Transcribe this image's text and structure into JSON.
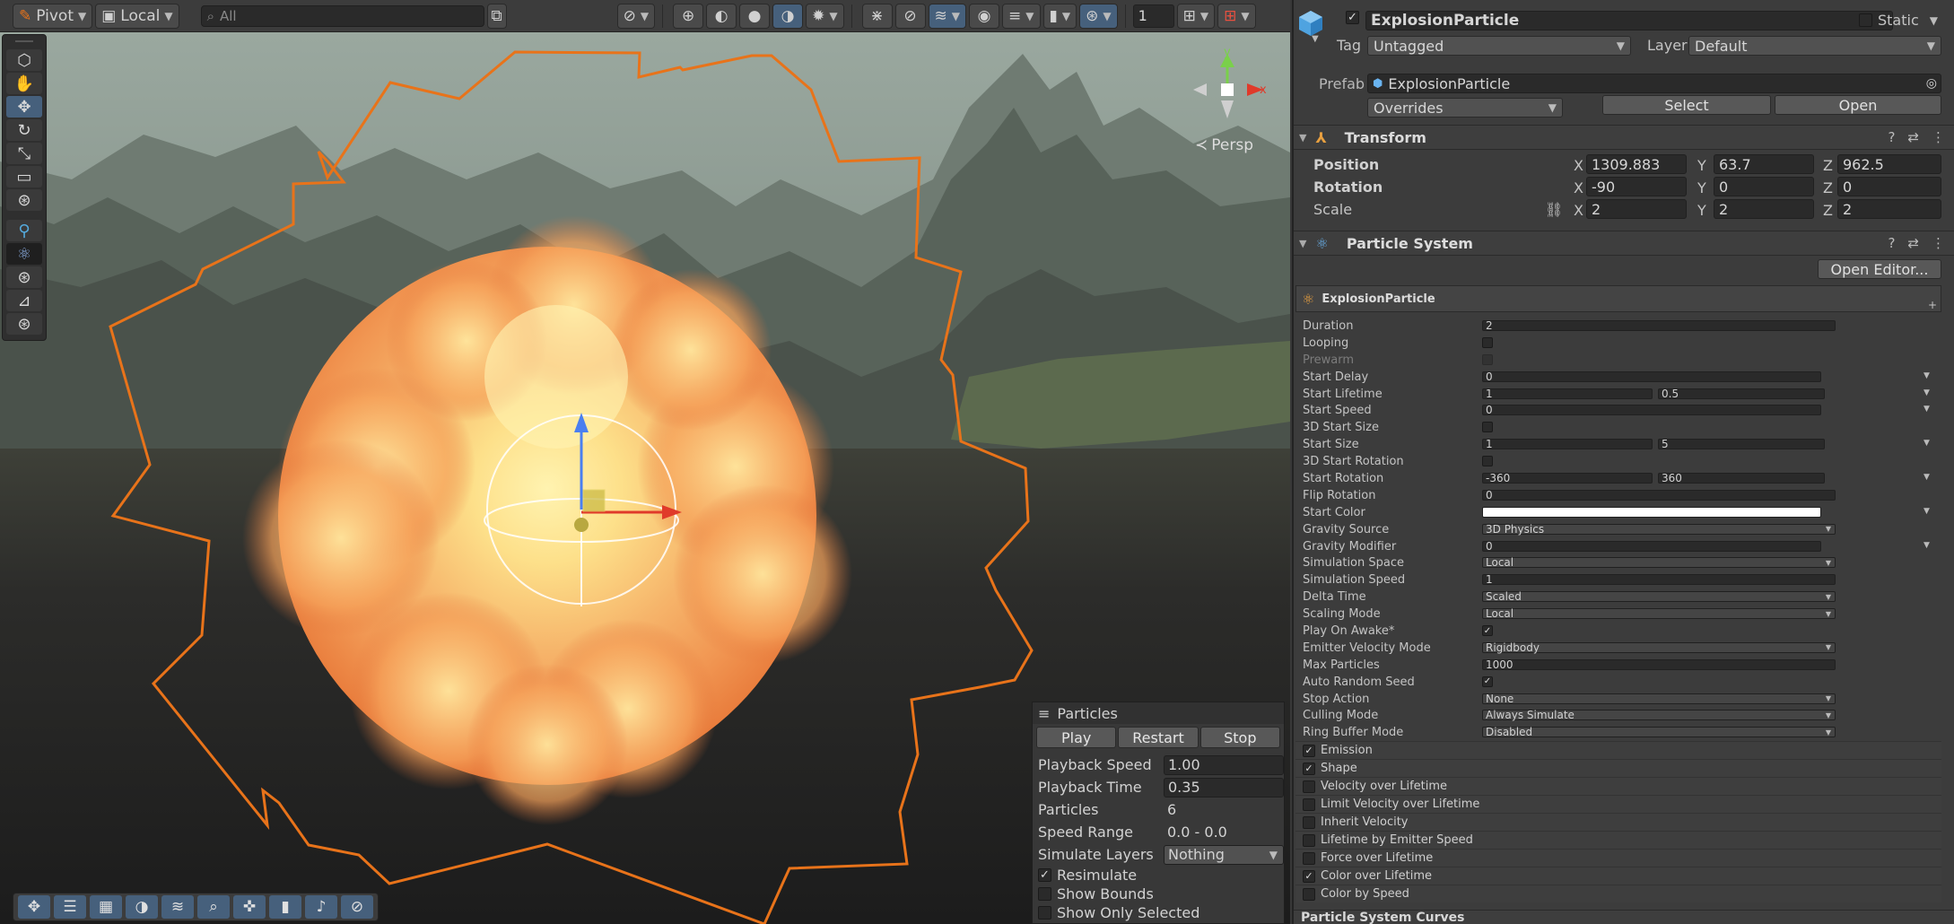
{
  "toolbar": {
    "pivot_label": "Pivot",
    "local_label": "Local",
    "search_placeholder": "All",
    "grid_count": "1"
  },
  "scene": {
    "persp_label": "Persp",
    "gizmo_axes": {
      "x": "x",
      "y": "y"
    }
  },
  "particles_overlay": {
    "title": "Particles",
    "play_label": "Play",
    "restart_label": "Restart",
    "stop_label": "Stop",
    "rows": [
      {
        "label": "Playback Speed",
        "value": "1.00"
      },
      {
        "label": "Playback Time",
        "value": "0.35"
      },
      {
        "label": "Particles",
        "value": "6"
      },
      {
        "label": "Speed Range",
        "value": "0.0 - 0.0"
      },
      {
        "label": "Simulate Layers",
        "value": "Nothing"
      }
    ],
    "checks": [
      {
        "label": "Resimulate",
        "checked": true
      },
      {
        "label": "Show Bounds",
        "checked": false
      },
      {
        "label": "Show Only Selected",
        "checked": false
      }
    ]
  },
  "inspector": {
    "object_name": "ExplosionParticle",
    "static_label": "Static",
    "tag_label": "Tag",
    "tag_value": "Untagged",
    "layer_label": "Layer",
    "layer_value": "Default",
    "prefab_label": "Prefab",
    "prefab_value": "ExplosionParticle",
    "overrides_label": "Overrides",
    "select_label": "Select",
    "open_label": "Open",
    "transform": {
      "title": "Transform",
      "position_label": "Position",
      "rotation_label": "Rotation",
      "scale_label": "Scale",
      "position": {
        "x": "1309.883",
        "y": "63.7",
        "z": "962.5"
      },
      "rotation": {
        "x": "-90",
        "y": "0",
        "z": "0"
      },
      "scale": {
        "x": "2",
        "y": "2",
        "z": "2"
      }
    },
    "particle_system": {
      "title": "Particle System",
      "open_editor_label": "Open Editor...",
      "system_name": "ExplosionParticle",
      "props": {
        "duration": {
          "label": "Duration",
          "value": "2"
        },
        "looping": {
          "label": "Looping"
        },
        "prewarm": {
          "label": "Prewarm"
        },
        "start_delay": {
          "label": "Start Delay",
          "value": "0"
        },
        "start_lifetime": {
          "label": "Start Lifetime",
          "value": "1",
          "value2": "0.5"
        },
        "start_speed": {
          "label": "Start Speed",
          "value": "0"
        },
        "start_size_3d": {
          "label": "3D Start Size"
        },
        "start_size": {
          "label": "Start Size",
          "value": "1",
          "value2": "5"
        },
        "start_rotation_3d": {
          "label": "3D Start Rotation"
        },
        "start_rotation": {
          "label": "Start Rotation",
          "value": "-360",
          "value2": "360"
        },
        "flip_rotation": {
          "label": "Flip Rotation",
          "value": "0"
        },
        "start_color": {
          "label": "Start Color",
          "value": "#ffffff"
        },
        "gravity_source": {
          "label": "Gravity Source",
          "value": "3D Physics"
        },
        "gravity_modifier": {
          "label": "Gravity Modifier",
          "value": "0"
        },
        "simulation_space": {
          "label": "Simulation Space",
          "value": "Local"
        },
        "simulation_speed": {
          "label": "Simulation Speed",
          "value": "1"
        },
        "delta_time": {
          "label": "Delta Time",
          "value": "Scaled"
        },
        "scaling_mode": {
          "label": "Scaling Mode",
          "value": "Local"
        },
        "play_on_awake": {
          "label": "Play On Awake*",
          "checked": true
        },
        "emitter_velocity_mode": {
          "label": "Emitter Velocity Mode",
          "value": "Rigidbody"
        },
        "max_particles": {
          "label": "Max Particles",
          "value": "1000"
        },
        "auto_random_seed": {
          "label": "Auto Random Seed",
          "checked": true
        },
        "stop_action": {
          "label": "Stop Action",
          "value": "None"
        },
        "culling_mode": {
          "label": "Culling Mode",
          "value": "Always Simulate"
        },
        "ring_buffer_mode": {
          "label": "Ring Buffer Mode",
          "value": "Disabled"
        }
      },
      "modules": [
        {
          "label": "Emission",
          "checked": true
        },
        {
          "label": "Shape",
          "checked": true
        },
        {
          "label": "Velocity over Lifetime",
          "checked": false
        },
        {
          "label": "Limit Velocity over Lifetime",
          "checked": false
        },
        {
          "label": "Inherit Velocity",
          "checked": false
        },
        {
          "label": "Lifetime by Emitter Speed",
          "checked": false
        },
        {
          "label": "Force over Lifetime",
          "checked": false
        },
        {
          "label": "Color over Lifetime",
          "checked": true
        },
        {
          "label": "Color by Speed",
          "checked": false
        }
      ],
      "curves_title": "Particle System Curves"
    }
  },
  "colors": {
    "accent": "#46607c",
    "selection_outline": "#e8731a",
    "panel_bg": "#3c3c3c",
    "field_bg": "#2a2a2a"
  }
}
